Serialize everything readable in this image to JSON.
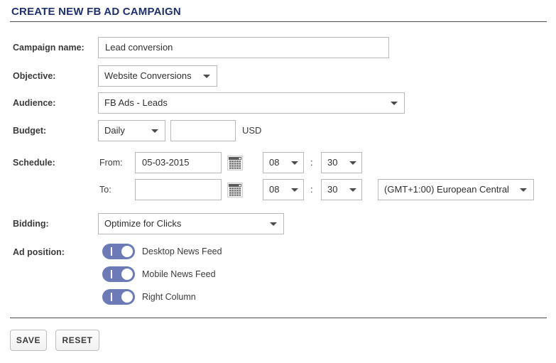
{
  "page": {
    "title": "CREATE NEW FB AD CAMPAIGN",
    "accent_color": "#1f3070",
    "toggle_on_color": "#6c7ab8"
  },
  "form": {
    "campaign_name": {
      "label": "Campaign name:",
      "value": "Lead conversion",
      "placeholder": ""
    },
    "objective": {
      "label": "Objective:",
      "value": "Website Conversions",
      "icon": "chevron-down-icon"
    },
    "audience": {
      "label": "Audience:",
      "value": "FB Ads - Leads",
      "icon": "chevron-down-icon"
    },
    "budget": {
      "label": "Budget:",
      "type_value": "Daily",
      "amount_value": "",
      "amount_placeholder": "",
      "currency": "USD"
    },
    "schedule": {
      "label": "Schedule:",
      "from": {
        "sub_label": "From:",
        "date_value": "05-03-2015",
        "date_placeholder": "",
        "calendar_icon": "calendar-icon",
        "hour": "08",
        "separator": ":",
        "minute": "30"
      },
      "to": {
        "sub_label": "To:",
        "date_value": "",
        "date_placeholder": "",
        "calendar_icon": "calendar-icon",
        "hour": "08",
        "separator": ":",
        "minute": "30",
        "timezone": "(GMT+1:00) European Central"
      }
    },
    "bidding": {
      "label": "Bidding:",
      "value": "Optimize for Clicks",
      "icon": "chevron-down-icon"
    },
    "ad_position": {
      "label": "Ad position:",
      "options": [
        {
          "label": "Desktop News Feed",
          "state": "on"
        },
        {
          "label": "Mobile News Feed",
          "state": "on"
        },
        {
          "label": "Right Column",
          "state": "on"
        }
      ]
    }
  },
  "actions": {
    "save_label": "SAVE",
    "reset_label": "RESET"
  }
}
